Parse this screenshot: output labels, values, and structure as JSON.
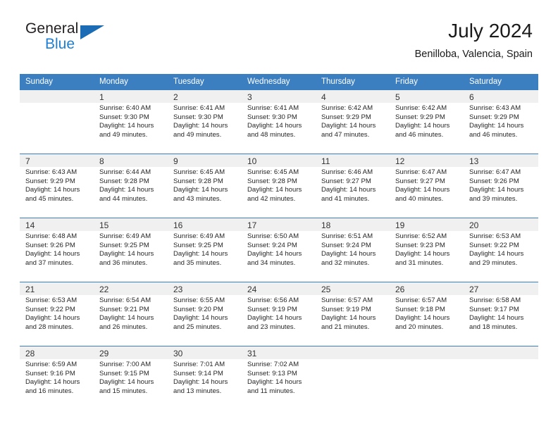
{
  "brand": {
    "name_part1": "General",
    "name_part2": "Blue",
    "accent_color": "#1c6cb5",
    "triangle_icon": "triangle-icon"
  },
  "header": {
    "title": "July 2024",
    "location": "Benilloba, Valencia, Spain"
  },
  "theme": {
    "header_bg": "#3c7fc1",
    "row_divider": "#3c7fc1",
    "daynum_band": "#f0f0f0"
  },
  "calendar": {
    "weekday_headers": [
      "Sunday",
      "Monday",
      "Tuesday",
      "Wednesday",
      "Thursday",
      "Friday",
      "Saturday"
    ],
    "weeks": [
      [
        {
          "day": "",
          "sunrise": "",
          "sunset": "",
          "daylight_line1": "",
          "daylight_line2": ""
        },
        {
          "day": "1",
          "sunrise": "Sunrise: 6:40 AM",
          "sunset": "Sunset: 9:30 PM",
          "daylight_line1": "Daylight: 14 hours",
          "daylight_line2": "and 49 minutes."
        },
        {
          "day": "2",
          "sunrise": "Sunrise: 6:41 AM",
          "sunset": "Sunset: 9:30 PM",
          "daylight_line1": "Daylight: 14 hours",
          "daylight_line2": "and 49 minutes."
        },
        {
          "day": "3",
          "sunrise": "Sunrise: 6:41 AM",
          "sunset": "Sunset: 9:30 PM",
          "daylight_line1": "Daylight: 14 hours",
          "daylight_line2": "and 48 minutes."
        },
        {
          "day": "4",
          "sunrise": "Sunrise: 6:42 AM",
          "sunset": "Sunset: 9:29 PM",
          "daylight_line1": "Daylight: 14 hours",
          "daylight_line2": "and 47 minutes."
        },
        {
          "day": "5",
          "sunrise": "Sunrise: 6:42 AM",
          "sunset": "Sunset: 9:29 PM",
          "daylight_line1": "Daylight: 14 hours",
          "daylight_line2": "and 46 minutes."
        },
        {
          "day": "6",
          "sunrise": "Sunrise: 6:43 AM",
          "sunset": "Sunset: 9:29 PM",
          "daylight_line1": "Daylight: 14 hours",
          "daylight_line2": "and 46 minutes."
        }
      ],
      [
        {
          "day": "7",
          "sunrise": "Sunrise: 6:43 AM",
          "sunset": "Sunset: 9:29 PM",
          "daylight_line1": "Daylight: 14 hours",
          "daylight_line2": "and 45 minutes."
        },
        {
          "day": "8",
          "sunrise": "Sunrise: 6:44 AM",
          "sunset": "Sunset: 9:28 PM",
          "daylight_line1": "Daylight: 14 hours",
          "daylight_line2": "and 44 minutes."
        },
        {
          "day": "9",
          "sunrise": "Sunrise: 6:45 AM",
          "sunset": "Sunset: 9:28 PM",
          "daylight_line1": "Daylight: 14 hours",
          "daylight_line2": "and 43 minutes."
        },
        {
          "day": "10",
          "sunrise": "Sunrise: 6:45 AM",
          "sunset": "Sunset: 9:28 PM",
          "daylight_line1": "Daylight: 14 hours",
          "daylight_line2": "and 42 minutes."
        },
        {
          "day": "11",
          "sunrise": "Sunrise: 6:46 AM",
          "sunset": "Sunset: 9:27 PM",
          "daylight_line1": "Daylight: 14 hours",
          "daylight_line2": "and 41 minutes."
        },
        {
          "day": "12",
          "sunrise": "Sunrise: 6:47 AM",
          "sunset": "Sunset: 9:27 PM",
          "daylight_line1": "Daylight: 14 hours",
          "daylight_line2": "and 40 minutes."
        },
        {
          "day": "13",
          "sunrise": "Sunrise: 6:47 AM",
          "sunset": "Sunset: 9:26 PM",
          "daylight_line1": "Daylight: 14 hours",
          "daylight_line2": "and 39 minutes."
        }
      ],
      [
        {
          "day": "14",
          "sunrise": "Sunrise: 6:48 AM",
          "sunset": "Sunset: 9:26 PM",
          "daylight_line1": "Daylight: 14 hours",
          "daylight_line2": "and 37 minutes."
        },
        {
          "day": "15",
          "sunrise": "Sunrise: 6:49 AM",
          "sunset": "Sunset: 9:25 PM",
          "daylight_line1": "Daylight: 14 hours",
          "daylight_line2": "and 36 minutes."
        },
        {
          "day": "16",
          "sunrise": "Sunrise: 6:49 AM",
          "sunset": "Sunset: 9:25 PM",
          "daylight_line1": "Daylight: 14 hours",
          "daylight_line2": "and 35 minutes."
        },
        {
          "day": "17",
          "sunrise": "Sunrise: 6:50 AM",
          "sunset": "Sunset: 9:24 PM",
          "daylight_line1": "Daylight: 14 hours",
          "daylight_line2": "and 34 minutes."
        },
        {
          "day": "18",
          "sunrise": "Sunrise: 6:51 AM",
          "sunset": "Sunset: 9:24 PM",
          "daylight_line1": "Daylight: 14 hours",
          "daylight_line2": "and 32 minutes."
        },
        {
          "day": "19",
          "sunrise": "Sunrise: 6:52 AM",
          "sunset": "Sunset: 9:23 PM",
          "daylight_line1": "Daylight: 14 hours",
          "daylight_line2": "and 31 minutes."
        },
        {
          "day": "20",
          "sunrise": "Sunrise: 6:53 AM",
          "sunset": "Sunset: 9:22 PM",
          "daylight_line1": "Daylight: 14 hours",
          "daylight_line2": "and 29 minutes."
        }
      ],
      [
        {
          "day": "21",
          "sunrise": "Sunrise: 6:53 AM",
          "sunset": "Sunset: 9:22 PM",
          "daylight_line1": "Daylight: 14 hours",
          "daylight_line2": "and 28 minutes."
        },
        {
          "day": "22",
          "sunrise": "Sunrise: 6:54 AM",
          "sunset": "Sunset: 9:21 PM",
          "daylight_line1": "Daylight: 14 hours",
          "daylight_line2": "and 26 minutes."
        },
        {
          "day": "23",
          "sunrise": "Sunrise: 6:55 AM",
          "sunset": "Sunset: 9:20 PM",
          "daylight_line1": "Daylight: 14 hours",
          "daylight_line2": "and 25 minutes."
        },
        {
          "day": "24",
          "sunrise": "Sunrise: 6:56 AM",
          "sunset": "Sunset: 9:19 PM",
          "daylight_line1": "Daylight: 14 hours",
          "daylight_line2": "and 23 minutes."
        },
        {
          "day": "25",
          "sunrise": "Sunrise: 6:57 AM",
          "sunset": "Sunset: 9:19 PM",
          "daylight_line1": "Daylight: 14 hours",
          "daylight_line2": "and 21 minutes."
        },
        {
          "day": "26",
          "sunrise": "Sunrise: 6:57 AM",
          "sunset": "Sunset: 9:18 PM",
          "daylight_line1": "Daylight: 14 hours",
          "daylight_line2": "and 20 minutes."
        },
        {
          "day": "27",
          "sunrise": "Sunrise: 6:58 AM",
          "sunset": "Sunset: 9:17 PM",
          "daylight_line1": "Daylight: 14 hours",
          "daylight_line2": "and 18 minutes."
        }
      ],
      [
        {
          "day": "28",
          "sunrise": "Sunrise: 6:59 AM",
          "sunset": "Sunset: 9:16 PM",
          "daylight_line1": "Daylight: 14 hours",
          "daylight_line2": "and 16 minutes."
        },
        {
          "day": "29",
          "sunrise": "Sunrise: 7:00 AM",
          "sunset": "Sunset: 9:15 PM",
          "daylight_line1": "Daylight: 14 hours",
          "daylight_line2": "and 15 minutes."
        },
        {
          "day": "30",
          "sunrise": "Sunrise: 7:01 AM",
          "sunset": "Sunset: 9:14 PM",
          "daylight_line1": "Daylight: 14 hours",
          "daylight_line2": "and 13 minutes."
        },
        {
          "day": "31",
          "sunrise": "Sunrise: 7:02 AM",
          "sunset": "Sunset: 9:13 PM",
          "daylight_line1": "Daylight: 14 hours",
          "daylight_line2": "and 11 minutes."
        },
        {
          "day": "",
          "sunrise": "",
          "sunset": "",
          "daylight_line1": "",
          "daylight_line2": ""
        },
        {
          "day": "",
          "sunrise": "",
          "sunset": "",
          "daylight_line1": "",
          "daylight_line2": ""
        },
        {
          "day": "",
          "sunrise": "",
          "sunset": "",
          "daylight_line1": "",
          "daylight_line2": ""
        }
      ]
    ]
  }
}
